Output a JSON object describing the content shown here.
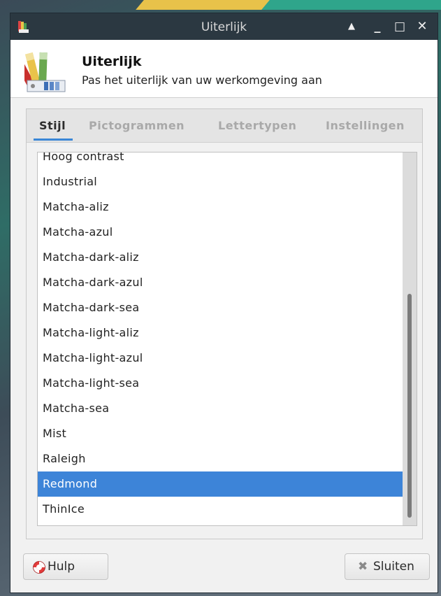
{
  "window": {
    "title": "Uiterlijk"
  },
  "titlebar": {
    "minimize_glyph": "_",
    "maximize_glyph": "□",
    "close_glyph": "✕",
    "shade_glyph": "▲"
  },
  "header": {
    "title": "Uiterlijk",
    "subtitle": "Pas het uiterlijk van uw werkomgeving aan"
  },
  "tabs": [
    {
      "label": "Stijl",
      "active": true
    },
    {
      "label": "Pictogrammen",
      "active": false
    },
    {
      "label": "Lettertypen",
      "active": false
    },
    {
      "label": "Instellingen",
      "active": false
    }
  ],
  "themes": {
    "items": [
      "Hoog contrast",
      "Industrial",
      "Matcha-aliz",
      "Matcha-azul",
      "Matcha-dark-aliz",
      "Matcha-dark-azul",
      "Matcha-dark-sea",
      "Matcha-light-aliz",
      "Matcha-light-azul",
      "Matcha-light-sea",
      "Matcha-sea",
      "Mist",
      "Raleigh",
      "Redmond",
      "ThinIce"
    ],
    "selected": "Redmond"
  },
  "buttons": {
    "help_label": "Hulp",
    "close_label": "Sluiten"
  },
  "colors": {
    "accent": "#3d84d8",
    "titlebar": "#2b3841"
  }
}
